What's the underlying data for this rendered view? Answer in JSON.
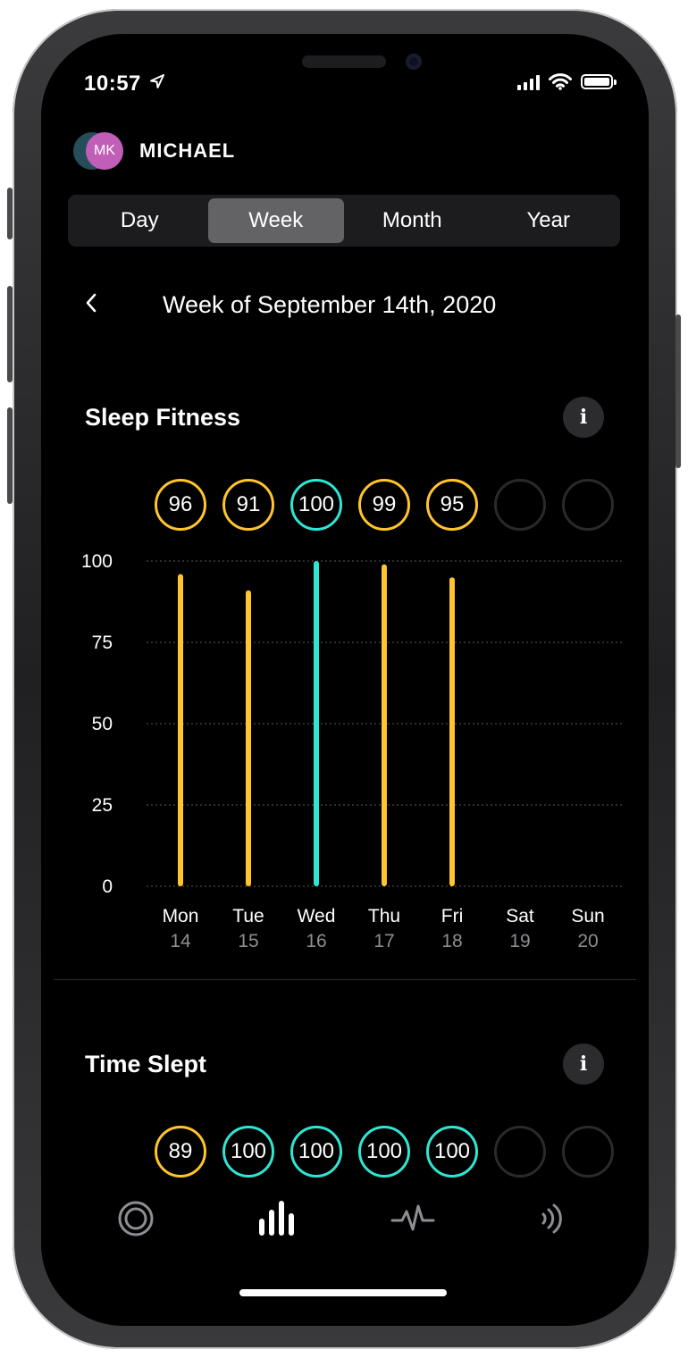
{
  "status_bar": {
    "time": "10:57"
  },
  "profile": {
    "initials": "MK",
    "name": "MICHAEL"
  },
  "period_tabs": [
    {
      "label": "Day",
      "active": false
    },
    {
      "label": "Week",
      "active": true
    },
    {
      "label": "Month",
      "active": false
    },
    {
      "label": "Year",
      "active": false
    }
  ],
  "week_title": "Week of September 14th, 2020",
  "colors": {
    "yellow": "#ffc42e",
    "cyan": "#2fe6d3",
    "empty_ring": "#2a2a2c"
  },
  "sleep_fitness": {
    "title": "Sleep Fitness",
    "info_icon": "info-icon",
    "scores": [
      "96",
      "91",
      "100",
      "99",
      "95",
      "",
      ""
    ],
    "score_colors": [
      "yellow",
      "yellow",
      "cyan",
      "yellow",
      "yellow",
      "empty",
      "empty"
    ]
  },
  "time_slept": {
    "title": "Time Slept",
    "info_icon": "info-icon",
    "scores": [
      "89",
      "100",
      "100",
      "100",
      "100",
      "",
      ""
    ],
    "score_colors": [
      "yellow",
      "cyan",
      "cyan",
      "cyan",
      "cyan",
      "empty",
      "empty"
    ]
  },
  "chart_data": {
    "type": "bar",
    "title": "Sleep Fitness",
    "categories": [
      "Mon",
      "Tue",
      "Wed",
      "Thu",
      "Fri",
      "Sat",
      "Sun"
    ],
    "dates": [
      "14",
      "15",
      "16",
      "17",
      "18",
      "19",
      "20"
    ],
    "values": [
      96,
      91,
      100,
      99,
      95,
      null,
      null
    ],
    "bar_colors": [
      "yellow",
      "yellow",
      "cyan",
      "yellow",
      "yellow",
      null,
      null
    ],
    "yticks": [
      "100",
      "75",
      "50",
      "25",
      "0"
    ],
    "ylim": [
      0,
      100
    ],
    "grid": true
  },
  "tab_bar": [
    {
      "icon": "ring-icon",
      "active": false
    },
    {
      "icon": "bar-chart-icon",
      "active": true
    },
    {
      "icon": "pulse-icon",
      "active": false
    },
    {
      "icon": "sound-waves-icon",
      "active": false
    }
  ]
}
